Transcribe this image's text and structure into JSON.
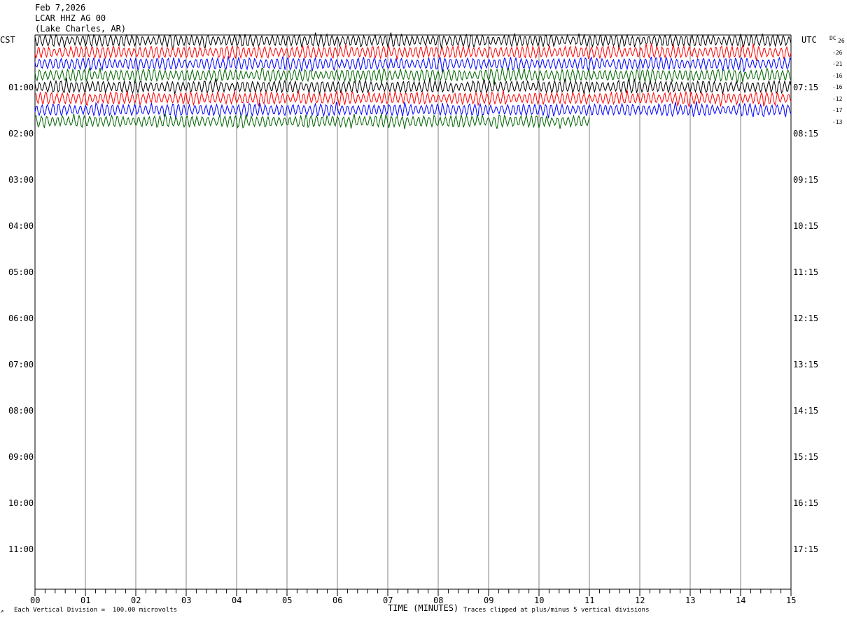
{
  "header": {
    "date": "Feb 7,2026",
    "station": "LCAR HHZ AG 00",
    "location": "(Lake Charles, AR)"
  },
  "left_tz": "CST",
  "right_tz": "UTC",
  "dc_label": "DC",
  "footer": {
    "scale_note": "Each Vertical Division =  100.00 microvolts",
    "axis_title": "TIME (MINUTES)",
    "clip_note": "Traces clipped at plus/minus 5 vertical divisions",
    "corner_mark": "↗"
  },
  "colors": {
    "trace_cycle": [
      "#000000",
      "#ff0000",
      "#0000ff",
      "#006400"
    ],
    "grid": "#808080",
    "frame": "#000000"
  },
  "chart_data": {
    "type": "line",
    "title": "LCAR HHZ AG 00",
    "xlabel": "TIME (MINUTES)",
    "x_ticks": [
      "00",
      "01",
      "02",
      "03",
      "04",
      "05",
      "06",
      "07",
      "08",
      "09",
      "10",
      "11",
      "12",
      "13",
      "14",
      "15"
    ],
    "x_range": [
      0,
      15
    ],
    "y_left_labels": [
      "01:00",
      "02:00",
      "03:00",
      "04:00",
      "05:00",
      "06:00",
      "07:00",
      "08:00",
      "09:00",
      "10:00",
      "11:00"
    ],
    "y_right_labels": [
      "07:15",
      "08:15",
      "09:15",
      "10:15",
      "11:15",
      "12:15",
      "13:15",
      "14:15",
      "15:15",
      "16:15",
      "17:15"
    ],
    "dc_offsets": [
      "26",
      "-26",
      "-21",
      "-16",
      "-16",
      "-12",
      "-17",
      "-13"
    ],
    "traces": [
      {
        "row": 0,
        "color": "black",
        "end_minute": 15
      },
      {
        "row": 1,
        "color": "red",
        "end_minute": 15
      },
      {
        "row": 2,
        "color": "blue",
        "end_minute": 15
      },
      {
        "row": 3,
        "color": "green",
        "end_minute": 15
      },
      {
        "row": 4,
        "color": "black",
        "end_minute": 15
      },
      {
        "row": 5,
        "color": "red",
        "end_minute": 15
      },
      {
        "row": 6,
        "color": "blue",
        "end_minute": 15
      },
      {
        "row": 7,
        "color": "green",
        "end_minute": 11
      }
    ],
    "grid": true
  }
}
